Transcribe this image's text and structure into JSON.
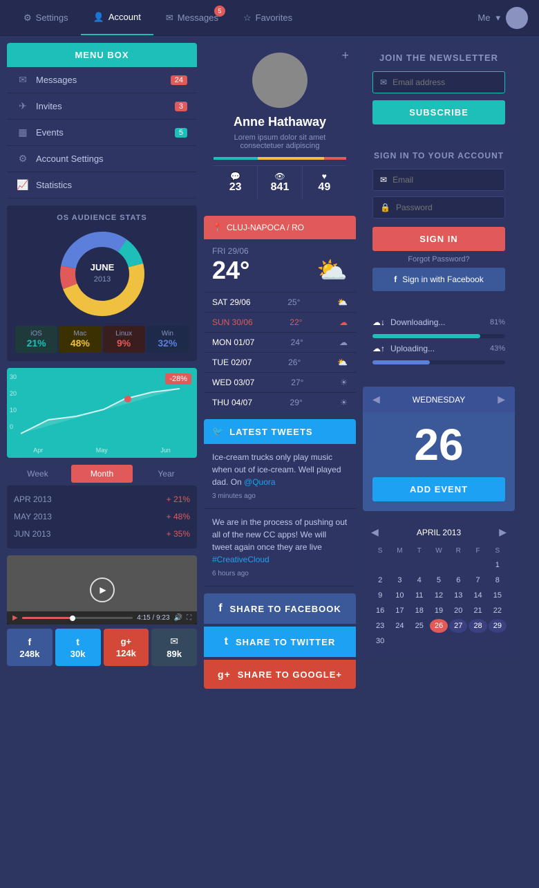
{
  "nav": {
    "items": [
      {
        "label": "Settings",
        "icon": "⚙",
        "active": false
      },
      {
        "label": "Account",
        "icon": "👤",
        "active": true
      },
      {
        "label": "Messages",
        "icon": "✉",
        "active": false,
        "badge": "5"
      },
      {
        "label": "Favorites",
        "icon": "☆",
        "active": false
      }
    ],
    "user_label": "Me",
    "chevron": "▾"
  },
  "menu_box": {
    "title": "MENU BOX",
    "items": [
      {
        "icon": "✉",
        "label": "Messages",
        "badge": "24",
        "badge_type": "gray"
      },
      {
        "icon": "✈",
        "label": "Invites",
        "badge": "3",
        "badge_type": "red"
      },
      {
        "icon": "📅",
        "label": "Events",
        "badge": "5",
        "badge_type": "teal"
      },
      {
        "icon": "⚙",
        "label": "Account Settings"
      },
      {
        "icon": "📈",
        "label": "Statistics"
      }
    ]
  },
  "os_stats": {
    "title": "OS AUDIENCE STATS",
    "center_label": "JUNE",
    "center_year": "2013",
    "segments": [
      {
        "label": "iOS",
        "pct": "21%",
        "color": "#1dbfb8"
      },
      {
        "label": "Mac",
        "pct": "48%",
        "color": "#f0c040"
      },
      {
        "label": "Linux",
        "pct": "9%",
        "color": "#e05a5a"
      },
      {
        "label": "Win",
        "pct": "32%",
        "color": "#5b7fdb"
      }
    ]
  },
  "chart": {
    "badge": "-28%",
    "y_labels": [
      "30",
      "20",
      "10",
      "0"
    ],
    "x_labels": [
      "Apr",
      "May",
      "Jun"
    ]
  },
  "tabs": {
    "items": [
      "Week",
      "Month",
      "Year"
    ],
    "active": "Month"
  },
  "stat_rows": [
    {
      "label": "APR 2013",
      "val": "+ 21%"
    },
    {
      "label": "MAY 2013",
      "val": "+ 48%"
    },
    {
      "label": "JUN 2013",
      "val": "+ 35%"
    }
  ],
  "video": {
    "time_current": "4:15",
    "time_total": "9:23",
    "progress_pct": 44
  },
  "social_counts": [
    {
      "icon": "f",
      "platform": "Facebook",
      "count": "248k",
      "color": "#3b5998"
    },
    {
      "icon": "t",
      "platform": "Twitter",
      "count": "30k",
      "color": "#1da1f2"
    },
    {
      "icon": "g+",
      "platform": "Google+",
      "count": "124k",
      "color": "#d34836"
    },
    {
      "icon": "✉",
      "platform": "Mail",
      "count": "89k",
      "color": "#34495e"
    }
  ],
  "profile": {
    "name": "Anne Hathaway",
    "bio": "Lorem ipsum dolor sit amet consectetuer adipiscing",
    "stats": [
      {
        "icon": "💬",
        "val": "23"
      },
      {
        "icon": "👁",
        "val": "841"
      },
      {
        "icon": "♥",
        "val": "49"
      }
    ],
    "add_icon": "+"
  },
  "weather": {
    "location": "CLUJ-NAPOCA / RO",
    "location_icon": "📍",
    "days": [
      {
        "day": "",
        "date": "FRI 29/06",
        "temp": "24°",
        "icon": "⛅",
        "main": true
      },
      {
        "day": "SAT 29/06",
        "temp": "25°",
        "icon": "⛅"
      },
      {
        "day": "SUN 30/06",
        "temp": "22°",
        "icon": "☁",
        "highlight": true
      },
      {
        "day": "MON 01/07",
        "temp": "24°",
        "icon": "☁"
      },
      {
        "day": "TUE 02/07",
        "temp": "26°",
        "icon": "⛅"
      },
      {
        "day": "WED 03/07",
        "temp": "27°",
        "icon": "☀"
      },
      {
        "day": "THU 04/07",
        "temp": "29°",
        "icon": "☀"
      }
    ]
  },
  "tweets": {
    "header": "LATEST TWEETS",
    "items": [
      {
        "text": "Ice-cream trucks only play music when out of ice-cream. Well played dad. On ",
        "link": "@Quora",
        "time": "3 minutes ago"
      },
      {
        "text": "We are in the process of pushing out all of the new CC apps! We will tweet again once they are live ",
        "link": "#CreativeCloud",
        "time": "6 hours ago"
      }
    ]
  },
  "share_buttons": [
    {
      "label": "SHARE TO FACEBOOK",
      "color": "#3b5998",
      "icon": "f"
    },
    {
      "label": "SHARE TO TWITTER",
      "color": "#1da1f2",
      "icon": "t"
    },
    {
      "label": "SHARE TO GOOGLE+",
      "color": "#d34836",
      "icon": "g+"
    }
  ],
  "newsletter": {
    "title": "JOIN THE NEWSLETTER",
    "email_placeholder": "Email address",
    "subscribe_label": "SUBSCRIBE"
  },
  "signin": {
    "title": "SIGN IN TO YOUR ACCOUNT",
    "email_placeholder": "Email",
    "password_placeholder": "Password",
    "signin_label": "SIGN IN",
    "forgot_label": "Forgot Password?",
    "fb_label": "Sign in with Facebook"
  },
  "transfers": {
    "downloading_label": "Downloading...",
    "downloading_pct": "81%",
    "downloading_val": 81,
    "uploading_label": "Uploading...",
    "uploading_pct": "43%",
    "uploading_val": 43
  },
  "cal_widget": {
    "day_name": "WEDNESDAY",
    "day_number": "26",
    "add_event_label": "ADD EVENT"
  },
  "mini_cal": {
    "month_label": "APRIL 2013",
    "day_headers": [
      "S",
      "M",
      "T",
      "W",
      "R",
      "F",
      "S"
    ],
    "weeks": [
      [
        "",
        "",
        "",
        "",
        "",
        "",
        "1"
      ],
      [
        "2",
        "3",
        "4",
        "5",
        "6",
        "7",
        "8"
      ],
      [
        "9",
        "10",
        "11",
        "12",
        "13",
        "14",
        "15"
      ],
      [
        "16",
        "17",
        "18",
        "19",
        "20",
        "21",
        "22"
      ],
      [
        "23",
        "24",
        "25",
        "26",
        "27",
        "28",
        "29"
      ],
      [
        "30",
        "",
        "",
        "",
        "",
        "",
        ""
      ]
    ],
    "today": "26",
    "highlights": [
      "27",
      "28",
      "29"
    ]
  }
}
